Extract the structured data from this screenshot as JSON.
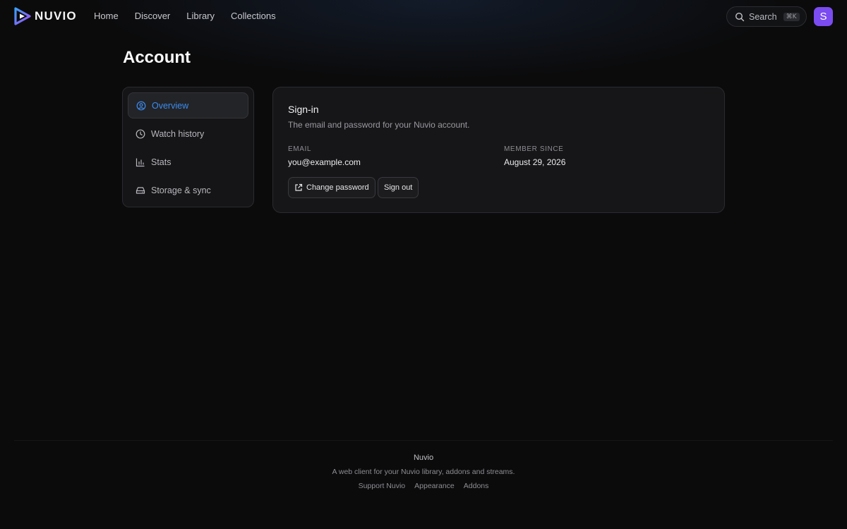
{
  "brand": {
    "name": "NUVIO"
  },
  "nav": {
    "items": [
      {
        "label": "Home"
      },
      {
        "label": "Discover"
      },
      {
        "label": "Library"
      },
      {
        "label": "Collections"
      }
    ]
  },
  "search": {
    "label": "Search",
    "shortcut": "⌘K"
  },
  "user": {
    "avatar_initial": "S",
    "avatar_color": "#7b4cf0"
  },
  "page": {
    "title": "Account"
  },
  "sidebar": {
    "items": [
      {
        "label": "Overview",
        "icon": "user-circle-icon",
        "active": true
      },
      {
        "label": "Watch history",
        "icon": "clock-icon"
      },
      {
        "label": "Stats",
        "icon": "bar-chart-icon"
      },
      {
        "label": "Storage & sync",
        "icon": "hard-drive-icon"
      }
    ]
  },
  "signin": {
    "title": "Sign-in",
    "subtitle": "The email and password for your Nuvio account.",
    "email_label": "EMAIL",
    "email_value": "you@example.com",
    "member_label": "MEMBER SINCE",
    "member_value": "August 29, 2026",
    "change_password_label": "Change password",
    "sign_out_label": "Sign out"
  },
  "footer": {
    "title": "Nuvio",
    "description": "A web client for your Nuvio library, addons and streams.",
    "links": [
      {
        "label": "Support Nuvio"
      },
      {
        "label": "Appearance"
      },
      {
        "label": "Addons"
      }
    ]
  },
  "colors": {
    "accent": "#3b8cf2",
    "background": "#0b0b0c",
    "card": "#161618"
  }
}
